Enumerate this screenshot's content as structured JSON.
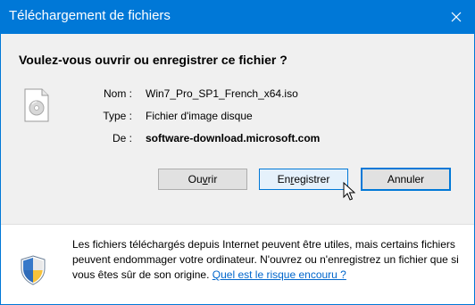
{
  "window": {
    "title": "Téléchargement de fichiers",
    "close_icon": "close-icon"
  },
  "question": "Voulez-vous ouvrir ou enregistrer ce fichier ?",
  "file": {
    "name_label": "Nom :",
    "name_value": "Win7_Pro_SP1_French_x64.iso",
    "type_label": "Type :",
    "type_value": "Fichier d'image disque",
    "from_label": "De :",
    "from_value": "software-download.microsoft.com",
    "icon": "disc-image-file-icon"
  },
  "buttons": {
    "open_pre": "Ou",
    "open_ul": "v",
    "open_post": "rir",
    "save_pre": "En",
    "save_ul": "r",
    "save_post": "egistrer",
    "cancel": "Annuler"
  },
  "footer": {
    "icon": "security-shield-icon",
    "text": "Les fichiers téléchargés depuis Internet peuvent être utiles, mais certains fichiers peuvent endommager votre ordinateur. N'ouvrez ou n'enregistrez un fichier que si vous êtes sûr de son origine.",
    "link": "Quel est le risque encouru ?"
  },
  "colors": {
    "titlebar": "#0078d7",
    "link": "#0066cc",
    "focus_border": "#0078d7"
  }
}
